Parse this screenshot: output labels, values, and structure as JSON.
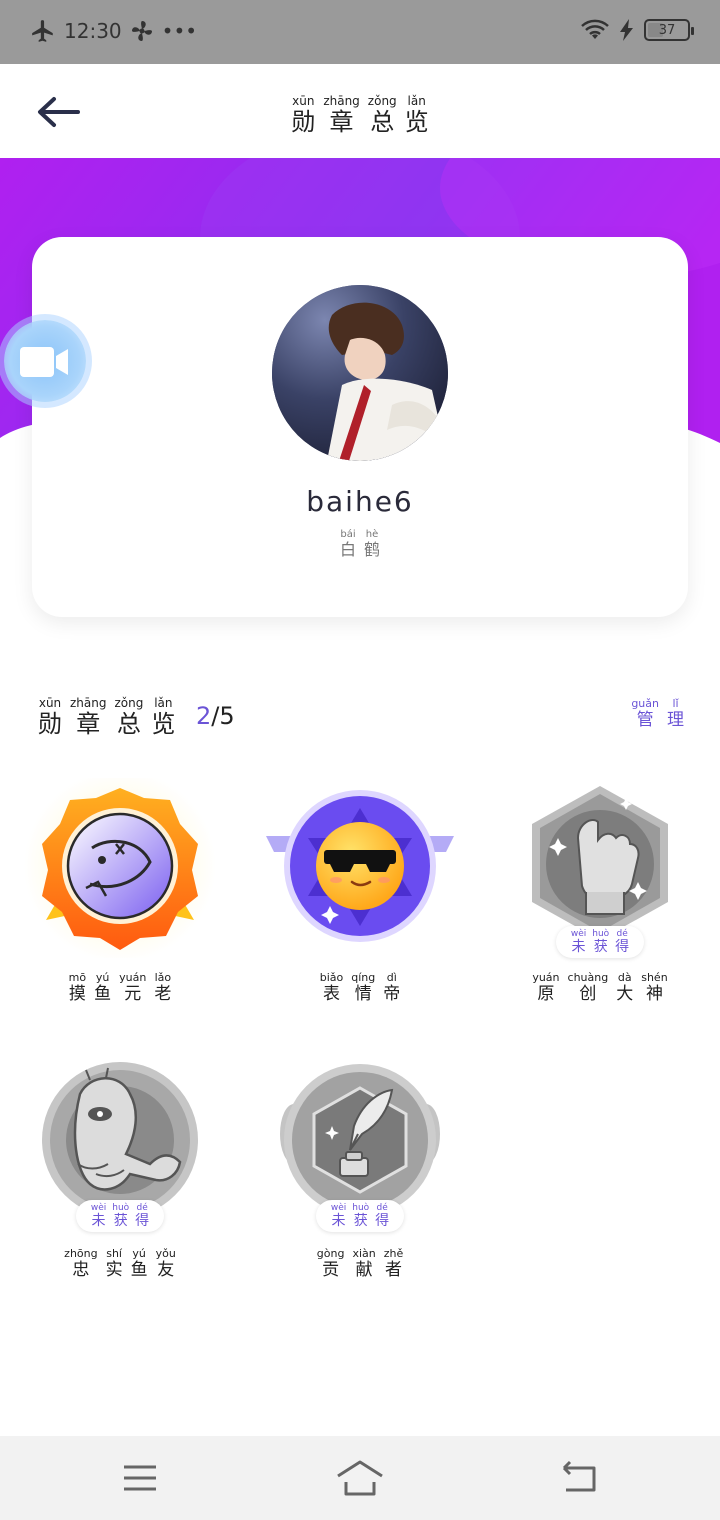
{
  "status_bar": {
    "time": "12:30",
    "dots": "•••",
    "battery": "37"
  },
  "header": {
    "title": [
      {
        "py": "xūn",
        "hz": "勋"
      },
      {
        "py": "zhāng",
        "hz": "章"
      },
      {
        "py": "zǒng",
        "hz": "总"
      },
      {
        "py": "lǎn",
        "hz": "览"
      }
    ]
  },
  "profile": {
    "username": "baihe6",
    "real_name": [
      {
        "py": "bái",
        "hz": "白"
      },
      {
        "py": "hè",
        "hz": "鹤"
      }
    ]
  },
  "section": {
    "title": [
      {
        "py": "xūn",
        "hz": "勋"
      },
      {
        "py": "zhāng",
        "hz": "章"
      },
      {
        "py": "zǒng",
        "hz": "总"
      },
      {
        "py": "lǎn",
        "hz": "览"
      }
    ],
    "obtained": "2",
    "total": "/5",
    "manage": [
      {
        "py": "guǎn",
        "hz": "管"
      },
      {
        "py": "lǐ",
        "hz": "理"
      }
    ]
  },
  "unobtained_label": [
    {
      "py": "wèi",
      "hz": "未"
    },
    {
      "py": "huò",
      "hz": "获"
    },
    {
      "py": "dé",
      "hz": "得"
    }
  ],
  "badges": [
    {
      "name": [
        {
          "py": "mō",
          "hz": "摸"
        },
        {
          "py": "yú",
          "hz": "鱼"
        },
        {
          "py": "yuán",
          "hz": "元"
        },
        {
          "py": "lǎo",
          "hz": "老"
        }
      ],
      "obtained": true
    },
    {
      "name": [
        {
          "py": "biǎo",
          "hz": "表"
        },
        {
          "py": "qíng",
          "hz": "情"
        },
        {
          "py": "dì",
          "hz": "帝"
        }
      ],
      "obtained": true
    },
    {
      "name": [
        {
          "py": "yuán",
          "hz": "原"
        },
        {
          "py": "chuàng",
          "hz": "创"
        },
        {
          "py": "dà",
          "hz": "大"
        },
        {
          "py": "shén",
          "hz": "神"
        }
      ],
      "obtained": false
    },
    {
      "name": [
        {
          "py": "zhōng",
          "hz": "忠"
        },
        {
          "py": "shí",
          "hz": "实"
        },
        {
          "py": "yú",
          "hz": "鱼"
        },
        {
          "py": "yǒu",
          "hz": "友"
        }
      ],
      "obtained": false
    },
    {
      "name": [
        {
          "py": "gòng",
          "hz": "贡"
        },
        {
          "py": "xiàn",
          "hz": "献"
        },
        {
          "py": "zhě",
          "hz": "者"
        }
      ],
      "obtained": false
    }
  ],
  "colors": {
    "accent": "#6b54d6",
    "hero_gradient_start": "#b020f0",
    "hero_gradient_end": "#7a3cf0"
  }
}
